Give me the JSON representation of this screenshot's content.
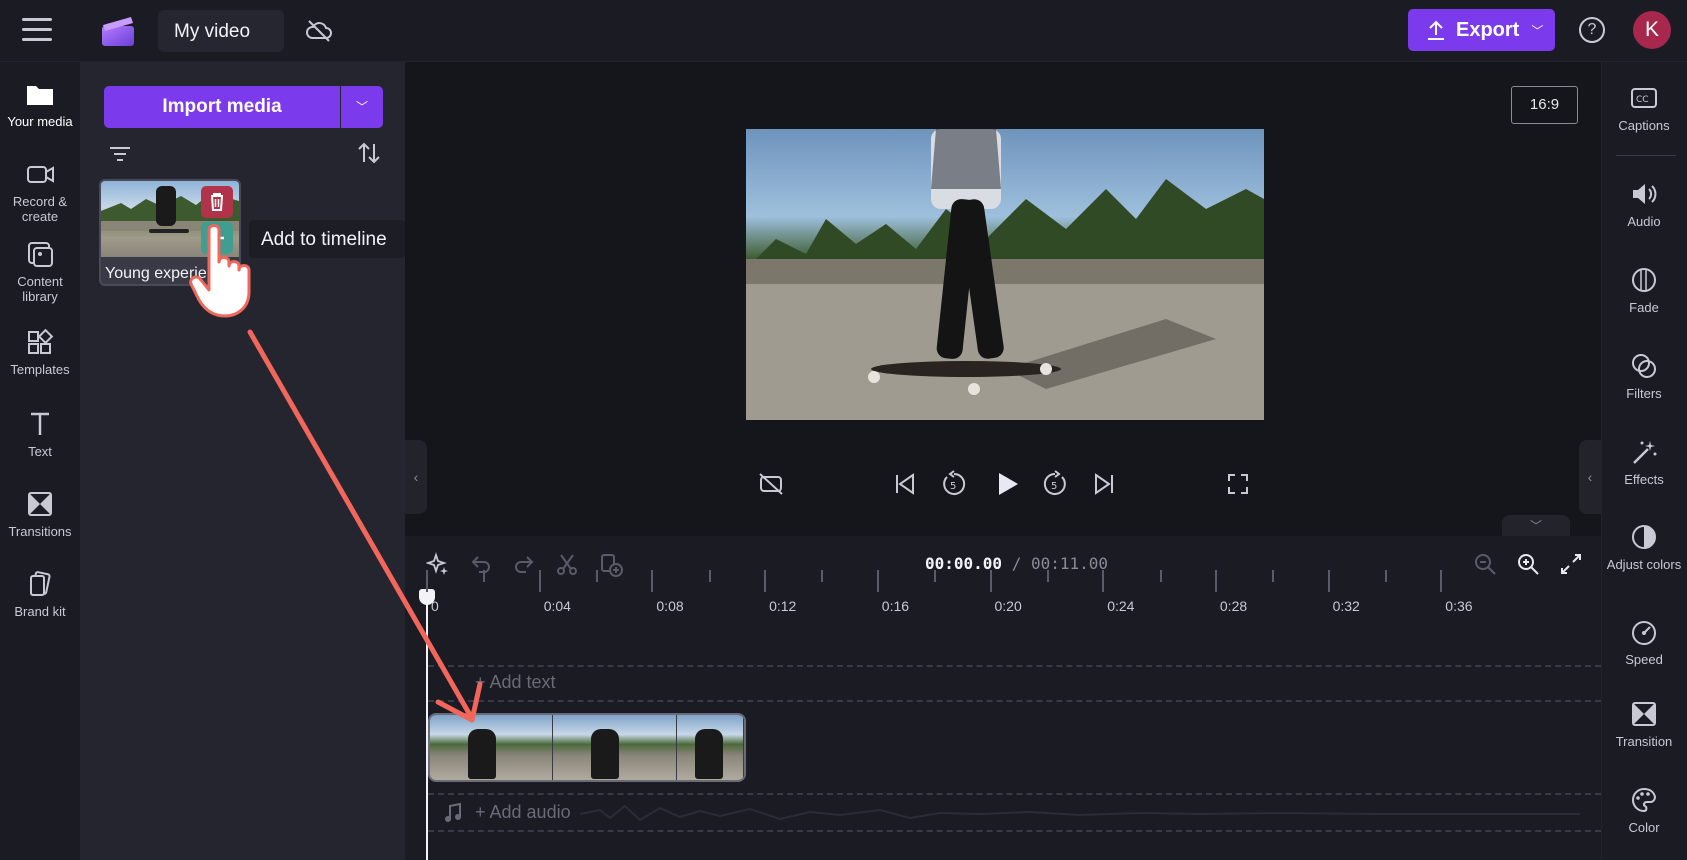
{
  "topbar": {
    "project_title": "My video",
    "export_label": "Export",
    "avatar_initial": "K",
    "help_label": "?"
  },
  "left_nav": {
    "items": [
      {
        "label": "Your media",
        "icon": "folder-icon",
        "active": true
      },
      {
        "label": "Record & create",
        "icon": "camera-icon"
      },
      {
        "label": "Content library",
        "icon": "content-library-icon"
      },
      {
        "label": "Templates",
        "icon": "templates-icon"
      },
      {
        "label": "Text",
        "icon": "text-icon"
      },
      {
        "label": "Transitions",
        "icon": "transitions-icon"
      },
      {
        "label": "Brand kit",
        "icon": "brand-kit-icon"
      }
    ]
  },
  "media_panel": {
    "import_label": "Import media",
    "media_item_label": "Young experie",
    "tooltip": "Add to timeline"
  },
  "preview": {
    "aspect_ratio": "16:9"
  },
  "timeline": {
    "current_time": "00:00.00",
    "separator": " / ",
    "total_time": "00:11.00",
    "ruler_labels": [
      "0",
      "0:04",
      "0:08",
      "0:12",
      "0:16",
      "0:20",
      "0:24",
      "0:28",
      "0:32",
      "0:36"
    ],
    "add_text_label": "+ Add text",
    "add_audio_label": "+ Add audio"
  },
  "right_nav": {
    "items": [
      {
        "label": "Captions",
        "icon": "captions-icon"
      },
      {
        "label": "Audio",
        "icon": "speaker-icon"
      },
      {
        "label": "Fade",
        "icon": "fade-icon"
      },
      {
        "label": "Filters",
        "icon": "filters-icon"
      },
      {
        "label": "Effects",
        "icon": "effects-wand-icon"
      },
      {
        "label": "Adjust colors",
        "icon": "adjust-colors-icon"
      },
      {
        "label": "Speed",
        "icon": "speedometer-icon"
      },
      {
        "label": "Transition",
        "icon": "transition-icon"
      },
      {
        "label": "Color",
        "icon": "palette-icon"
      }
    ]
  },
  "colors": {
    "accent": "#7c3aed",
    "annotation_arrow": "#f2665c",
    "avatar": "#a8274d",
    "delete": "#b0334a",
    "add": "#3f9e8f"
  }
}
